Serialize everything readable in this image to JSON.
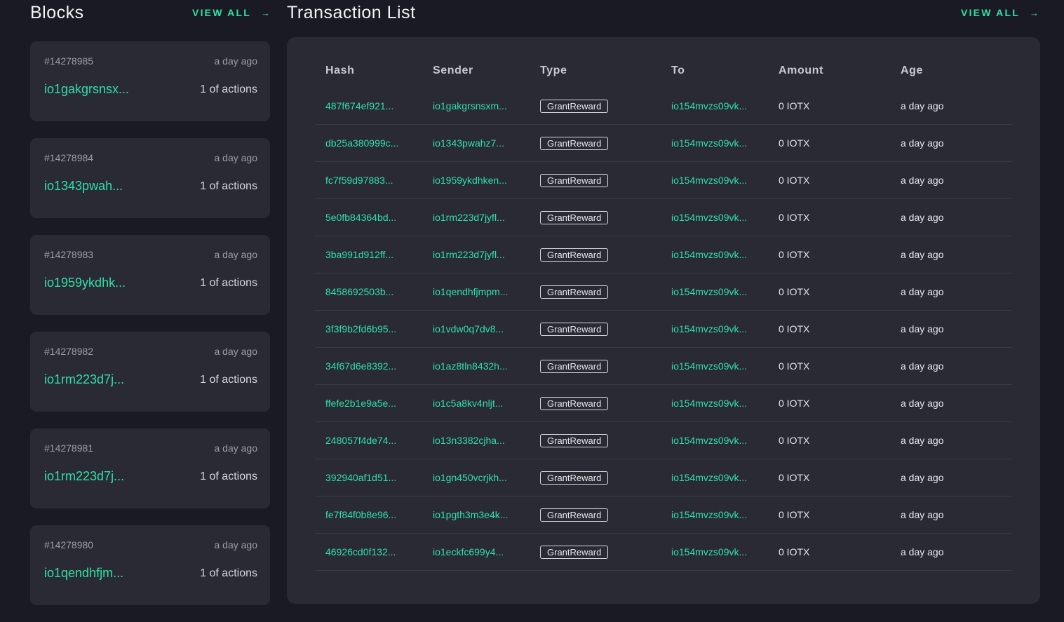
{
  "blocks": {
    "title": "Blocks",
    "view_all": "VIEW ALL",
    "items": [
      {
        "height": "#14278985",
        "age": "a day ago",
        "producer": "io1gakgrsnsx...",
        "actions": "1 of actions"
      },
      {
        "height": "#14278984",
        "age": "a day ago",
        "producer": "io1343pwah...",
        "actions": "1 of actions"
      },
      {
        "height": "#14278983",
        "age": "a day ago",
        "producer": "io1959ykdhk...",
        "actions": "1 of actions"
      },
      {
        "height": "#14278982",
        "age": "a day ago",
        "producer": "io1rm223d7j...",
        "actions": "1 of actions"
      },
      {
        "height": "#14278981",
        "age": "a day ago",
        "producer": "io1rm223d7j...",
        "actions": "1 of actions"
      },
      {
        "height": "#14278980",
        "age": "a day ago",
        "producer": "io1qendhfjm...",
        "actions": "1 of actions"
      }
    ]
  },
  "transactions": {
    "title": "Transaction List",
    "view_all": "VIEW ALL",
    "columns": [
      "Hash",
      "Sender",
      "Type",
      "To",
      "Amount",
      "Age"
    ],
    "rows": [
      {
        "hash": "487f674ef921...",
        "sender": "io1gakgrsnsxm...",
        "type": "GrantReward",
        "to": "io154mvzs09vk...",
        "amount": "0 IOTX",
        "age": "a day ago"
      },
      {
        "hash": "db25a380999c...",
        "sender": "io1343pwahz7...",
        "type": "GrantReward",
        "to": "io154mvzs09vk...",
        "amount": "0 IOTX",
        "age": "a day ago"
      },
      {
        "hash": "fc7f59d97883...",
        "sender": "io1959ykdhken...",
        "type": "GrantReward",
        "to": "io154mvzs09vk...",
        "amount": "0 IOTX",
        "age": "a day ago"
      },
      {
        "hash": "5e0fb84364bd...",
        "sender": "io1rm223d7jyfl...",
        "type": "GrantReward",
        "to": "io154mvzs09vk...",
        "amount": "0 IOTX",
        "age": "a day ago"
      },
      {
        "hash": "3ba991d912ff...",
        "sender": "io1rm223d7jyfl...",
        "type": "GrantReward",
        "to": "io154mvzs09vk...",
        "amount": "0 IOTX",
        "age": "a day ago"
      },
      {
        "hash": "8458692503b...",
        "sender": "io1qendhfjmpm...",
        "type": "GrantReward",
        "to": "io154mvzs09vk...",
        "amount": "0 IOTX",
        "age": "a day ago"
      },
      {
        "hash": "3f3f9b2fd6b95...",
        "sender": "io1vdw0q7dv8...",
        "type": "GrantReward",
        "to": "io154mvzs09vk...",
        "amount": "0 IOTX",
        "age": "a day ago"
      },
      {
        "hash": "34f67d6e8392...",
        "sender": "io1az8tln8432h...",
        "type": "GrantReward",
        "to": "io154mvzs09vk...",
        "amount": "0 IOTX",
        "age": "a day ago"
      },
      {
        "hash": "ffefe2b1e9a5e...",
        "sender": "io1c5a8kv4nljt...",
        "type": "GrantReward",
        "to": "io154mvzs09vk...",
        "amount": "0 IOTX",
        "age": "a day ago"
      },
      {
        "hash": "248057f4de74...",
        "sender": "io13n3382cjha...",
        "type": "GrantReward",
        "to": "io154mvzs09vk...",
        "amount": "0 IOTX",
        "age": "a day ago"
      },
      {
        "hash": "392940af1d51...",
        "sender": "io1gn450vcrjkh...",
        "type": "GrantReward",
        "to": "io154mvzs09vk...",
        "amount": "0 IOTX",
        "age": "a day ago"
      },
      {
        "hash": "fe7f84f0b8e96...",
        "sender": "io1pgth3m3e4k...",
        "type": "GrantReward",
        "to": "io154mvzs09vk...",
        "amount": "0 IOTX",
        "age": "a day ago"
      },
      {
        "hash": "46926cd0f132...",
        "sender": "io1eckfc699y4...",
        "type": "GrantReward",
        "to": "io154mvzs09vk...",
        "amount": "0 IOTX",
        "age": "a day ago"
      }
    ]
  },
  "icons": {
    "view_all_arrow": "arrow-right-icon"
  },
  "colors": {
    "accent": "#2fe0a8",
    "background": "#1a1a24",
    "card": "#2a2a35"
  }
}
